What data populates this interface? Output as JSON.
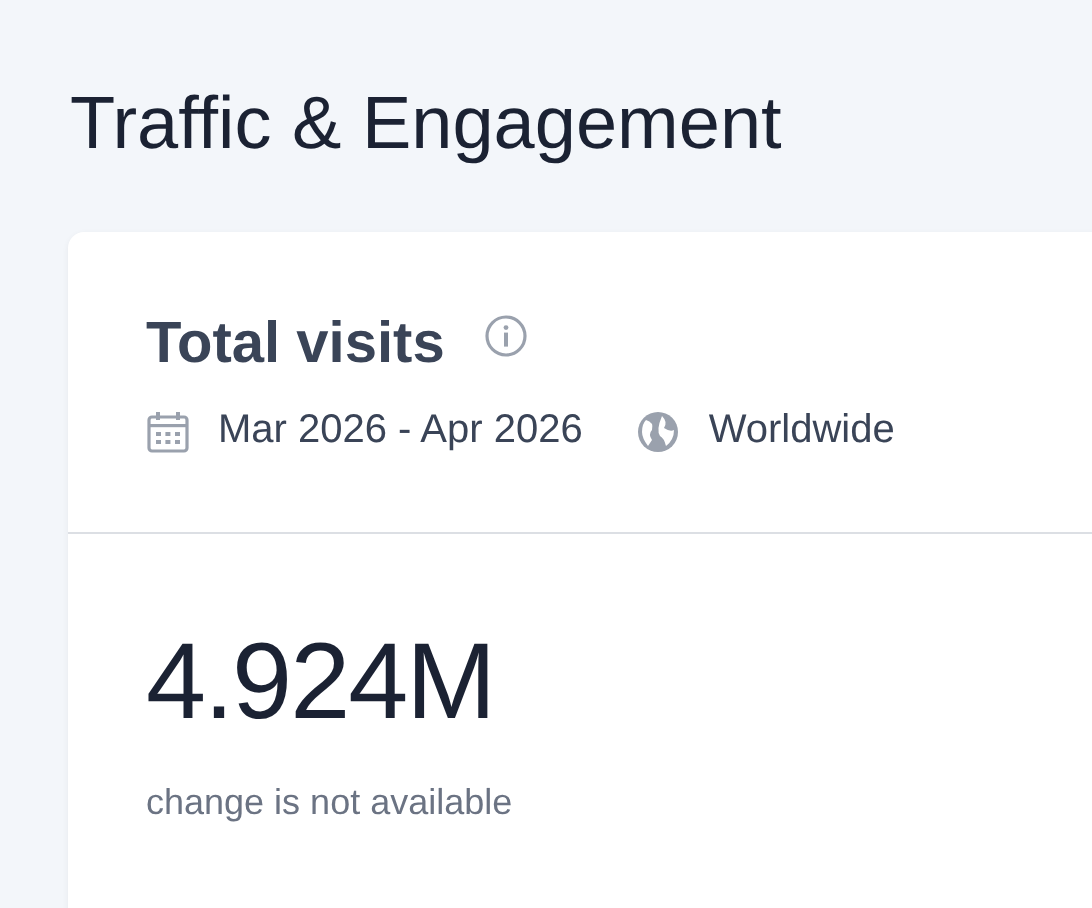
{
  "page": {
    "title": "Traffic & Engagement"
  },
  "card": {
    "title": "Total visits",
    "date_range": "Mar 2026 - Apr 2026",
    "region": "Worldwide",
    "value": "4.924M",
    "change": "change is not available"
  }
}
